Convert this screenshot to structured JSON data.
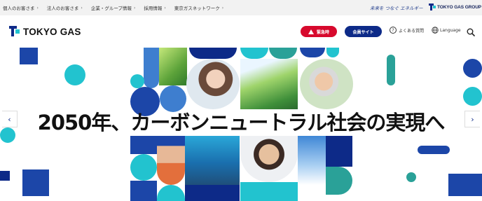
{
  "topbar": {
    "links": [
      {
        "label": "個人のお客さま"
      },
      {
        "label": "法人のお客さま"
      },
      {
        "label": "企業・グループ情報"
      },
      {
        "label": "採用情報"
      },
      {
        "label": "東京ガスネットワーク"
      }
    ],
    "tagline": "未来を つなぐ エネルギー",
    "group_logo": "TOKYO GAS GROUP"
  },
  "header": {
    "logo": "TOKYO GAS",
    "emergency_label": "緊急時",
    "member_label": "会員サイト",
    "faq_label": "よくある質問",
    "language_label": "Language"
  },
  "hero": {
    "headline": "2050年、カーボンニュートラル社会の実現へ",
    "prev_arrow": "‹",
    "next_arrow": "›"
  },
  "colors": {
    "navy": "#0d2a88",
    "blue": "#1c46a8",
    "teal": "#22c3cf",
    "green": "#2aa198",
    "red": "#d7092d",
    "light_blue": "#3e7ecf"
  },
  "icons": [
    "chevron-right-icon",
    "warning-icon",
    "question-icon",
    "globe-icon",
    "search-icon",
    "chevron-left-icon"
  ]
}
